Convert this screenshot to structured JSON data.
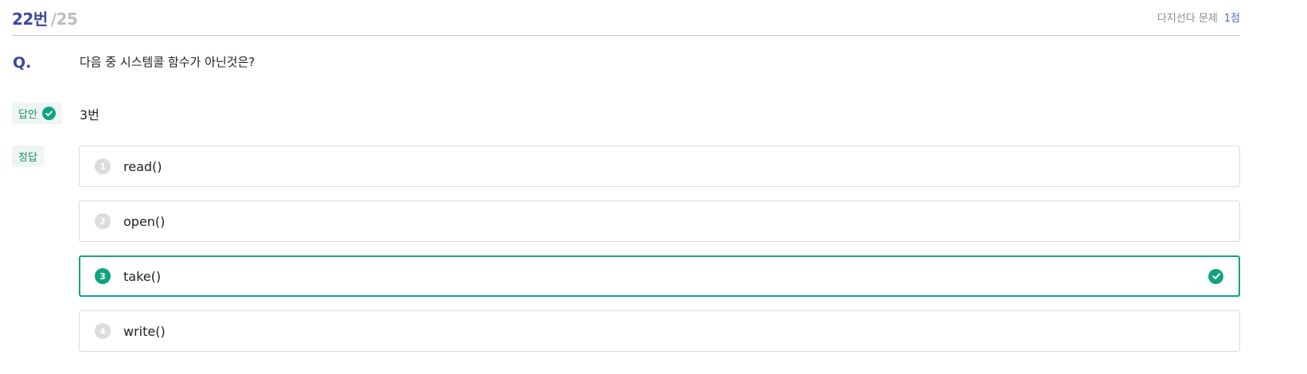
{
  "header": {
    "question_number": "22번",
    "total": "/25",
    "question_type": "다지선다 문제",
    "points": "1점"
  },
  "question": {
    "label": "Q.",
    "text": "다음 중 시스템콜 함수가 아닌것은?"
  },
  "answer": {
    "label": "답안",
    "value": "3번",
    "status_icon": "check-circle-icon"
  },
  "correct": {
    "label": "정답"
  },
  "options": [
    {
      "number": "1",
      "text": "read()",
      "selected": false
    },
    {
      "number": "2",
      "text": "open()",
      "selected": false
    },
    {
      "number": "3",
      "text": "take()",
      "selected": true
    },
    {
      "number": "4",
      "text": "write()",
      "selected": false
    }
  ],
  "colors": {
    "accent": "#11a37f",
    "title": "#3b4a9e",
    "muted": "#bdbdbd",
    "points": "#5a67c4"
  }
}
